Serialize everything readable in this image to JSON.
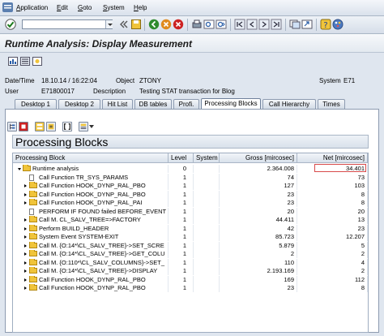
{
  "menu": {
    "items": [
      {
        "label": "Application",
        "underline": "A"
      },
      {
        "label": "Edit",
        "underline": "E"
      },
      {
        "label": "Goto",
        "underline": "G"
      },
      {
        "label": "System",
        "underline": "S"
      },
      {
        "label": "Help",
        "underline": "H"
      }
    ]
  },
  "toolbar": {
    "command_field_value": "",
    "icons": [
      "enter-icon",
      "save-icon",
      "back-icon",
      "exit-icon",
      "cancel-icon",
      "print-icon",
      "find-icon",
      "find-next-icon",
      "first-page-icon",
      "previous-page-icon",
      "next-page-icon",
      "last-page-icon",
      "create-session-icon",
      "shortcut-icon",
      "help-icon",
      "layout-icon"
    ]
  },
  "title": "Runtime Analysis: Display Measurement",
  "header": {
    "datetime_label": "Date/Time",
    "datetime_value": "18.10.14  /  16:22:04",
    "object_label": "Object",
    "object_value": "ZTONY",
    "system_label": "System",
    "system_value": "E71",
    "user_label": "User",
    "user_value": "E71800017",
    "description_label": "Description",
    "description_value": "Testing STAT transaction for Blog"
  },
  "tabs": [
    {
      "label": "Desktop 1"
    },
    {
      "label": "Desktop 2"
    },
    {
      "label": "Hit List"
    },
    {
      "label": "DB tables"
    },
    {
      "label": "Profi."
    },
    {
      "label": "Processing Blocks"
    },
    {
      "label": "Call Hierarchy"
    },
    {
      "label": "Times"
    }
  ],
  "active_tab": "Processing Blocks",
  "section_title": "Processing Blocks",
  "table": {
    "columns": [
      "Processing Block",
      "Level",
      "System",
      "Gross [mircosec]",
      "Net [mircosec]"
    ],
    "rows": [
      {
        "name": "Runtime analysis",
        "icon": "folder",
        "expand": "open",
        "indent": 0,
        "level": "0",
        "system": "",
        "gross": "2.364.008",
        "net": "34.401"
      },
      {
        "name": "Call Function TR_SYS_PARAMS",
        "icon": "doc",
        "expand": "none",
        "indent": 1,
        "level": "1",
        "system": "",
        "gross": "74",
        "net": "73"
      },
      {
        "name": "Call Function HOOK_DYNP_RAL_PBO",
        "icon": "folder",
        "expand": "closed",
        "indent": 1,
        "level": "1",
        "system": "",
        "gross": "127",
        "net": "103"
      },
      {
        "name": "Call Function HOOK_DYNP_RAL_PBO",
        "icon": "folder",
        "expand": "closed",
        "indent": 1,
        "level": "1",
        "system": "",
        "gross": "23",
        "net": "8"
      },
      {
        "name": "Call Function HOOK_DYNP_RAL_PAI",
        "icon": "folder",
        "expand": "closed",
        "indent": 1,
        "level": "1",
        "system": "",
        "gross": "23",
        "net": "8"
      },
      {
        "name": "PERFORM IF FOUND failed BEFORE_EVENT",
        "icon": "doc",
        "expand": "none",
        "indent": 1,
        "level": "1",
        "system": "",
        "gross": "20",
        "net": "20"
      },
      {
        "name": "Call M. CL_SALV_TREE=>FACTORY",
        "icon": "folder",
        "expand": "closed",
        "indent": 1,
        "level": "1",
        "system": "",
        "gross": "44.411",
        "net": "13"
      },
      {
        "name": "Perform BUILD_HEADER",
        "icon": "folder",
        "expand": "closed",
        "indent": 1,
        "level": "1",
        "system": "",
        "gross": "42",
        "net": "23"
      },
      {
        "name": "System Event SYSTEM-EXIT",
        "icon": "folder",
        "expand": "closed",
        "indent": 1,
        "level": "1",
        "system": "",
        "gross": "85.723",
        "net": "12.207"
      },
      {
        "name": "Call M. {O:14*\\CL_SALV_TREE}->SET_SCRE",
        "icon": "folder",
        "expand": "closed",
        "indent": 1,
        "level": "1",
        "system": "",
        "gross": "5.879",
        "net": "5"
      },
      {
        "name": "Call M. {O:14*\\CL_SALV_TREE}->GET_COLU",
        "icon": "folder",
        "expand": "closed",
        "indent": 1,
        "level": "1",
        "system": "",
        "gross": "2",
        "net": "2"
      },
      {
        "name": "Call M. {O:110*\\CL_SALV_COLUMNS}->SET_",
        "icon": "folder",
        "expand": "closed",
        "indent": 1,
        "level": "1",
        "system": "",
        "gross": "110",
        "net": "4"
      },
      {
        "name": "Call M. {O:14*\\CL_SALV_TREE}->DISPLAY",
        "icon": "folder",
        "expand": "closed",
        "indent": 1,
        "level": "1",
        "system": "",
        "gross": "2.193.169",
        "net": "2"
      },
      {
        "name": "Call Function HOOK_DYNP_RAL_PBO",
        "icon": "folder",
        "expand": "closed",
        "indent": 1,
        "level": "1",
        "system": "",
        "gross": "169",
        "net": "112"
      },
      {
        "name": "Call Function HOOK_DYNP_RAL_PBO",
        "icon": "folder",
        "expand": "closed",
        "indent": 1,
        "level": "1",
        "system": "",
        "gross": "23",
        "net": "8"
      }
    ]
  },
  "colors": {
    "background": "#dfe6ef",
    "panel": "#ffffff",
    "highlight_border": "#d84b4b"
  }
}
